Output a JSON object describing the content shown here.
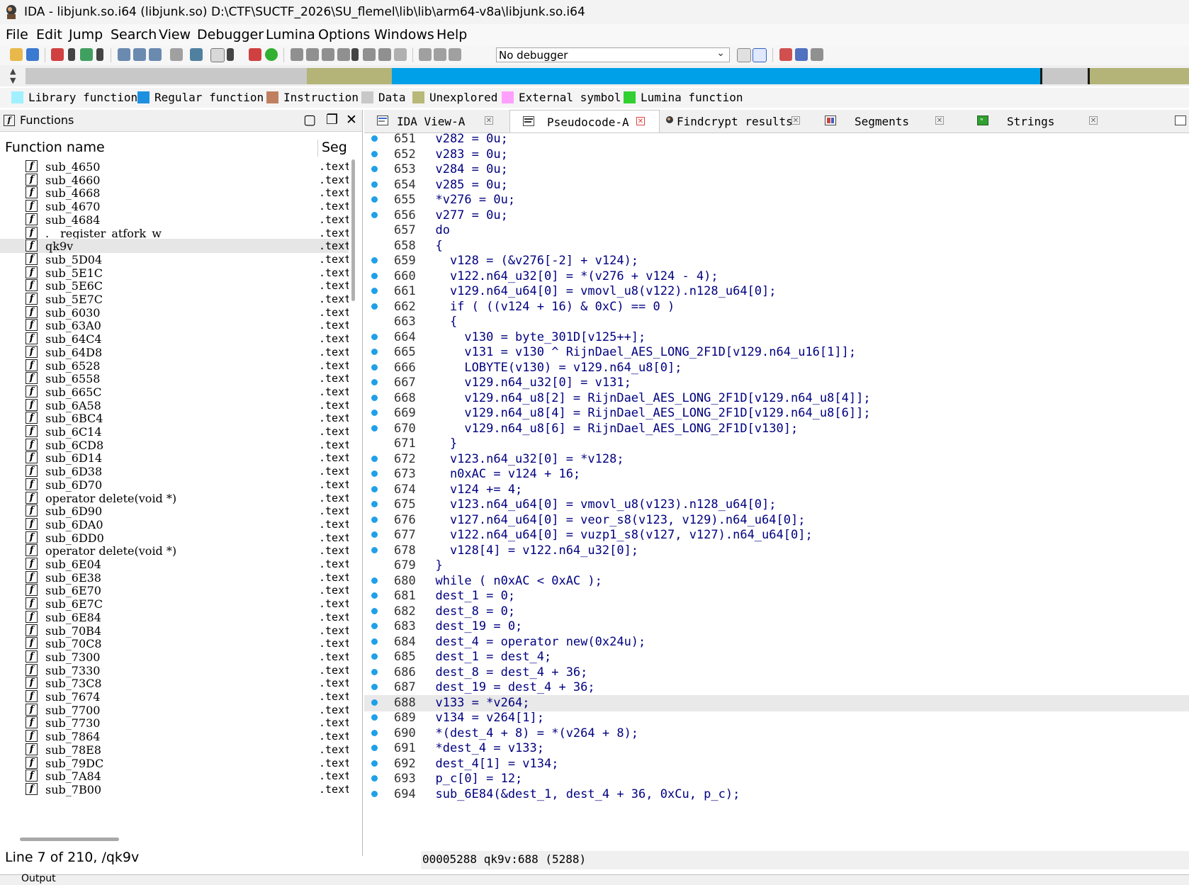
{
  "window": {
    "title": "IDA - libjunk.so.i64 (libjunk.so) D:\\CTF\\SUCTF_2026\\SU_flemel\\lib\\lib\\arm64-v8a\\libjunk.so.i64"
  },
  "menu": [
    "File",
    "Edit",
    "Jump",
    "Search",
    "View",
    "Debugger",
    "Lumina",
    "Options",
    "Windows",
    "Help"
  ],
  "toolbar": {
    "debugger_select": "No debugger"
  },
  "legend": [
    {
      "label": "Library function",
      "color": "#a0f0ff"
    },
    {
      "label": "Regular function",
      "color": "#1e90e0"
    },
    {
      "label": "Instruction",
      "color": "#c08060"
    },
    {
      "label": "Data",
      "color": "#c8c8c8"
    },
    {
      "label": "Unexplored",
      "color": "#b8b878"
    },
    {
      "label": "External symbol",
      "color": "#ffa0ff"
    },
    {
      "label": "Lumina function",
      "color": "#30d030"
    }
  ],
  "navbar_colors": {
    "unexplored": "#b4b478",
    "data": "#c8c8c8",
    "regular": "#00a0e8",
    "instruction": "#1a1a1a"
  },
  "functions_panel": {
    "title": "Functions",
    "col_name": "Function name",
    "col_seg": "Seg",
    "icon_glyph": "f",
    "items": [
      {
        "name": "sub_4650",
        "seg": ".text"
      },
      {
        "name": "sub_4660",
        "seg": ".text"
      },
      {
        "name": "sub_4668",
        "seg": ".text"
      },
      {
        "name": "sub_4670",
        "seg": ".text"
      },
      {
        "name": "sub_4684",
        "seg": ".text"
      },
      {
        "name": ".__register_atfork_w",
        "seg": ".text"
      },
      {
        "name": "qk9v",
        "seg": ".text"
      },
      {
        "name": "sub_5D04",
        "seg": ".text"
      },
      {
        "name": "sub_5E1C",
        "seg": ".text"
      },
      {
        "name": "sub_5E6C",
        "seg": ".text"
      },
      {
        "name": "sub_5E7C",
        "seg": ".text"
      },
      {
        "name": "sub_6030",
        "seg": ".text"
      },
      {
        "name": "sub_63A0",
        "seg": ".text"
      },
      {
        "name": "sub_64C4",
        "seg": ".text"
      },
      {
        "name": "sub_64D8",
        "seg": ".text"
      },
      {
        "name": "sub_6528",
        "seg": ".text"
      },
      {
        "name": "sub_6558",
        "seg": ".text"
      },
      {
        "name": "sub_665C",
        "seg": ".text"
      },
      {
        "name": "sub_6A58",
        "seg": ".text"
      },
      {
        "name": "sub_6BC4",
        "seg": ".text"
      },
      {
        "name": "sub_6C14",
        "seg": ".text"
      },
      {
        "name": "sub_6CD8",
        "seg": ".text"
      },
      {
        "name": "sub_6D14",
        "seg": ".text"
      },
      {
        "name": "sub_6D38",
        "seg": ".text"
      },
      {
        "name": "sub_6D70",
        "seg": ".text"
      },
      {
        "name": "operator delete(void *)",
        "seg": ".text"
      },
      {
        "name": "sub_6D90",
        "seg": ".text"
      },
      {
        "name": "sub_6DA0",
        "seg": ".text"
      },
      {
        "name": "sub_6DD0",
        "seg": ".text"
      },
      {
        "name": "operator delete(void *)",
        "seg": ".text"
      },
      {
        "name": "sub_6E04",
        "seg": ".text"
      },
      {
        "name": "sub_6E38",
        "seg": ".text"
      },
      {
        "name": "sub_6E70",
        "seg": ".text"
      },
      {
        "name": "sub_6E7C",
        "seg": ".text"
      },
      {
        "name": "sub_6E84",
        "seg": ".text"
      },
      {
        "name": "sub_70B4",
        "seg": ".text"
      },
      {
        "name": "sub_70C8",
        "seg": ".text"
      },
      {
        "name": "sub_7300",
        "seg": ".text"
      },
      {
        "name": "sub_7330",
        "seg": ".text"
      },
      {
        "name": "sub_73C8",
        "seg": ".text"
      },
      {
        "name": "sub_7674",
        "seg": ".text"
      },
      {
        "name": "sub_7700",
        "seg": ".text"
      },
      {
        "name": "sub_7730",
        "seg": ".text"
      },
      {
        "name": "sub_7864",
        "seg": ".text"
      },
      {
        "name": "sub_78E8",
        "seg": ".text"
      },
      {
        "name": "sub_79DC",
        "seg": ".text"
      },
      {
        "name": "sub_7A84",
        "seg": ".text"
      },
      {
        "name": "sub_7B00",
        "seg": ".text"
      }
    ],
    "selected_index": 6,
    "status": "Line 7 of 210, /qk9v"
  },
  "tabs": [
    {
      "label": "IDA View-A",
      "active": false
    },
    {
      "label": "Pseudocode-A",
      "active": true
    },
    {
      "label": "Findcrypt results",
      "active": false
    },
    {
      "label": "Segments",
      "active": false
    },
    {
      "label": "Strings",
      "active": false
    }
  ],
  "code": {
    "current_line": 688,
    "lines": [
      {
        "n": 651,
        "dot": true,
        "text": "  v282 = 0u;"
      },
      {
        "n": 652,
        "dot": true,
        "text": "  v283 = 0u;"
      },
      {
        "n": 653,
        "dot": true,
        "text": "  v284 = 0u;"
      },
      {
        "n": 654,
        "dot": true,
        "text": "  v285 = 0u;"
      },
      {
        "n": 655,
        "dot": true,
        "text": "  *v276 = 0u;"
      },
      {
        "n": 656,
        "dot": true,
        "text": "  v277 = 0u;"
      },
      {
        "n": 657,
        "dot": false,
        "text": "  do"
      },
      {
        "n": 658,
        "dot": false,
        "text": "  {"
      },
      {
        "n": 659,
        "dot": true,
        "text": "    v128 = (&v276[-2] + v124);"
      },
      {
        "n": 660,
        "dot": true,
        "text": "    v122.n64_u32[0] = *(v276 + v124 - 4);"
      },
      {
        "n": 661,
        "dot": true,
        "text": "    v129.n64_u64[0] = vmovl_u8(v122).n128_u64[0];"
      },
      {
        "n": 662,
        "dot": true,
        "text": "    if ( ((v124 + 16) & 0xC) == 0 )"
      },
      {
        "n": 663,
        "dot": false,
        "text": "    {"
      },
      {
        "n": 664,
        "dot": true,
        "text": "      v130 = byte_301D[v125++];"
      },
      {
        "n": 665,
        "dot": true,
        "text": "      v131 = v130 ^ RijnDael_AES_LONG_2F1D[v129.n64_u16[1]];"
      },
      {
        "n": 666,
        "dot": true,
        "text": "      LOBYTE(v130) = v129.n64_u8[0];"
      },
      {
        "n": 667,
        "dot": true,
        "text": "      v129.n64_u32[0] = v131;"
      },
      {
        "n": 668,
        "dot": true,
        "text": "      v129.n64_u8[2] = RijnDael_AES_LONG_2F1D[v129.n64_u8[4]];"
      },
      {
        "n": 669,
        "dot": true,
        "text": "      v129.n64_u8[4] = RijnDael_AES_LONG_2F1D[v129.n64_u8[6]];"
      },
      {
        "n": 670,
        "dot": true,
        "text": "      v129.n64_u8[6] = RijnDael_AES_LONG_2F1D[v130];"
      },
      {
        "n": 671,
        "dot": false,
        "text": "    }"
      },
      {
        "n": 672,
        "dot": true,
        "text": "    v123.n64_u32[0] = *v128;"
      },
      {
        "n": 673,
        "dot": true,
        "text": "    n0xAC = v124 + 16;"
      },
      {
        "n": 674,
        "dot": true,
        "text": "    v124 += 4;"
      },
      {
        "n": 675,
        "dot": true,
        "text": "    v123.n64_u64[0] = vmovl_u8(v123).n128_u64[0];"
      },
      {
        "n": 676,
        "dot": true,
        "text": "    v127.n64_u64[0] = veor_s8(v123, v129).n64_u64[0];"
      },
      {
        "n": 677,
        "dot": true,
        "text": "    v122.n64_u64[0] = vuzp1_s8(v127, v127).n64_u64[0];"
      },
      {
        "n": 678,
        "dot": true,
        "text": "    v128[4] = v122.n64_u32[0];"
      },
      {
        "n": 679,
        "dot": false,
        "text": "  }"
      },
      {
        "n": 680,
        "dot": true,
        "text": "  while ( n0xAC < 0xAC );"
      },
      {
        "n": 681,
        "dot": true,
        "text": "  dest_1 = 0;"
      },
      {
        "n": 682,
        "dot": true,
        "text": "  dest_8 = 0;"
      },
      {
        "n": 683,
        "dot": true,
        "text": "  dest_19 = 0;"
      },
      {
        "n": 684,
        "dot": true,
        "text": "  dest_4 = operator new(0x24u);"
      },
      {
        "n": 685,
        "dot": true,
        "text": "  dest_1 = dest_4;"
      },
      {
        "n": 686,
        "dot": true,
        "text": "  dest_8 = dest_4 + 36;"
      },
      {
        "n": 687,
        "dot": true,
        "text": "  dest_19 = dest_4 + 36;"
      },
      {
        "n": 688,
        "dot": true,
        "text": "  v133 = *v264;"
      },
      {
        "n": 689,
        "dot": true,
        "text": "  v134 = v264[1];"
      },
      {
        "n": 690,
        "dot": true,
        "text": "  *(dest_4 + 8) = *(v264 + 8);"
      },
      {
        "n": 691,
        "dot": true,
        "text": "  *dest_4 = v133;"
      },
      {
        "n": 692,
        "dot": true,
        "text": "  dest_4[1] = v134;"
      },
      {
        "n": 693,
        "dot": true,
        "text": "  p_c[0] = 12;"
      },
      {
        "n": 694,
        "dot": true,
        "text": "  sub_6E84(&dest_1, dest_4 + 36, 0xCu, p_c);"
      }
    ],
    "status": "00005288 qk9v:688 (5288)"
  },
  "output_label": "Output"
}
